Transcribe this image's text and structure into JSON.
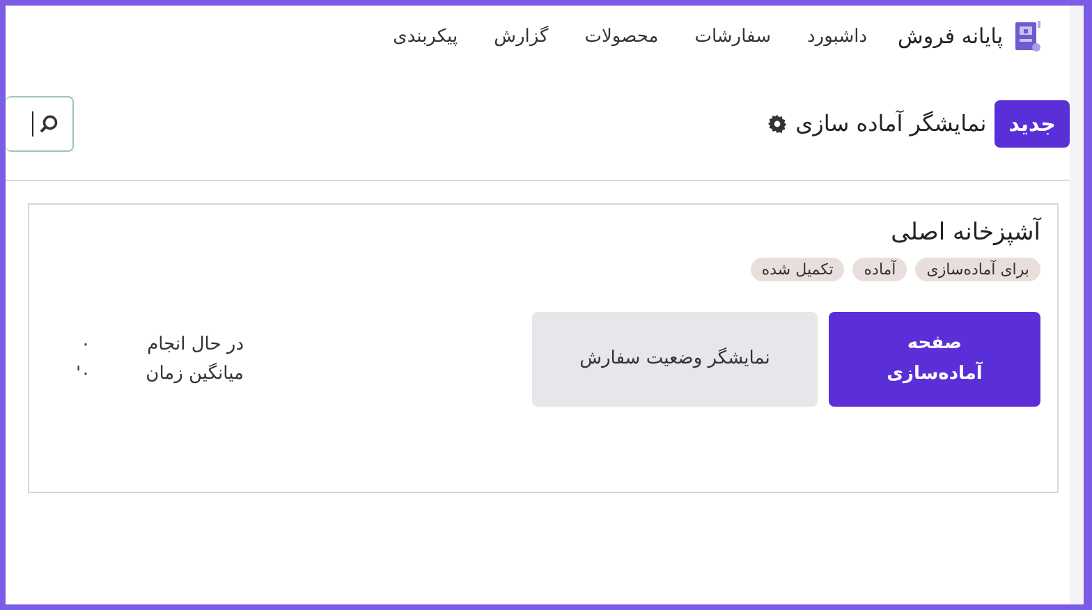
{
  "app": {
    "name": "پایانه فروش"
  },
  "nav": [
    "داشبورد",
    "سفارشات",
    "محصولات",
    "گزارش",
    "پیکربندی"
  ],
  "toolbar": {
    "new_button": "جدید",
    "title": "نمایشگر آماده سازی"
  },
  "card": {
    "title": "آشپزخانه اصلی",
    "tags": [
      "برای آماده‌سازی",
      "آماده",
      "تکمیل شده"
    ],
    "buttons": [
      {
        "label": "صفحه آماده‌سازی",
        "kind": "primary"
      },
      {
        "label": "نمایشگر وضعیت سفارش",
        "kind": "secondary"
      }
    ],
    "stats": [
      {
        "label": "در حال انجام",
        "value": "۰"
      },
      {
        "label": "میانگین زمان",
        "value": "۰'"
      }
    ]
  }
}
